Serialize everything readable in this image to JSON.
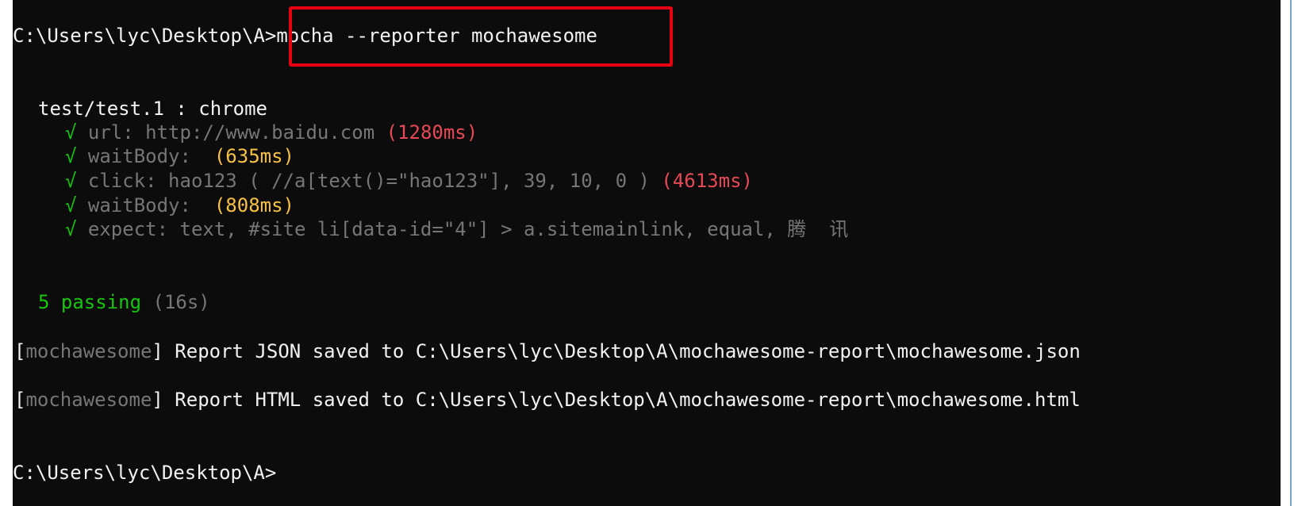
{
  "prompt_top": {
    "path": "C:\\Users\\lyc\\Desktop\\A",
    "gt": ">",
    "command": "mocha --reporter mochawesome"
  },
  "suite": {
    "title": "test/test.1 : chrome"
  },
  "tests": [
    {
      "check": "√",
      "label": "url: http://www.baidu.com",
      "duration": "(1280ms)",
      "speed": "slow"
    },
    {
      "check": "√",
      "label": "waitBody:",
      "duration": "(635ms)",
      "speed": "medium"
    },
    {
      "check": "√",
      "label": "click: hao123 ( //a[text()=\"hao123\"], 39, 10, 0 )",
      "duration": "(4613ms)",
      "speed": "slow"
    },
    {
      "check": "√",
      "label": "waitBody:",
      "duration": "(808ms)",
      "speed": "medium"
    },
    {
      "check": "√",
      "label": "expect: text, #site li[data-id=\"4\"] > a.sitemainlink, equal, 腾  讯",
      "duration": "",
      "speed": "fast"
    }
  ],
  "summary": {
    "passing": "5 passing",
    "time": "(16s)"
  },
  "reports": [
    {
      "tag": "mochawesome",
      "open": "[",
      "close": "]",
      "text": " Report JSON saved to C:\\Users\\lyc\\Desktop\\A\\mochawesome-report\\mochawesome.json"
    },
    {
      "tag": "mochawesome",
      "open": "[",
      "close": "]",
      "text": " Report HTML saved to C:\\Users\\lyc\\Desktop\\A\\mochawesome-report\\mochawesome.html"
    }
  ],
  "prompt_bottom": {
    "text": "C:\\Users\\lyc\\Desktop\\A>"
  },
  "colors": {
    "background": "#0c0c0c",
    "text": "#cccccc",
    "pass": "#16c60c",
    "slow": "#e74856",
    "medium": "#f9c143",
    "annotation_box": "#e60012"
  }
}
